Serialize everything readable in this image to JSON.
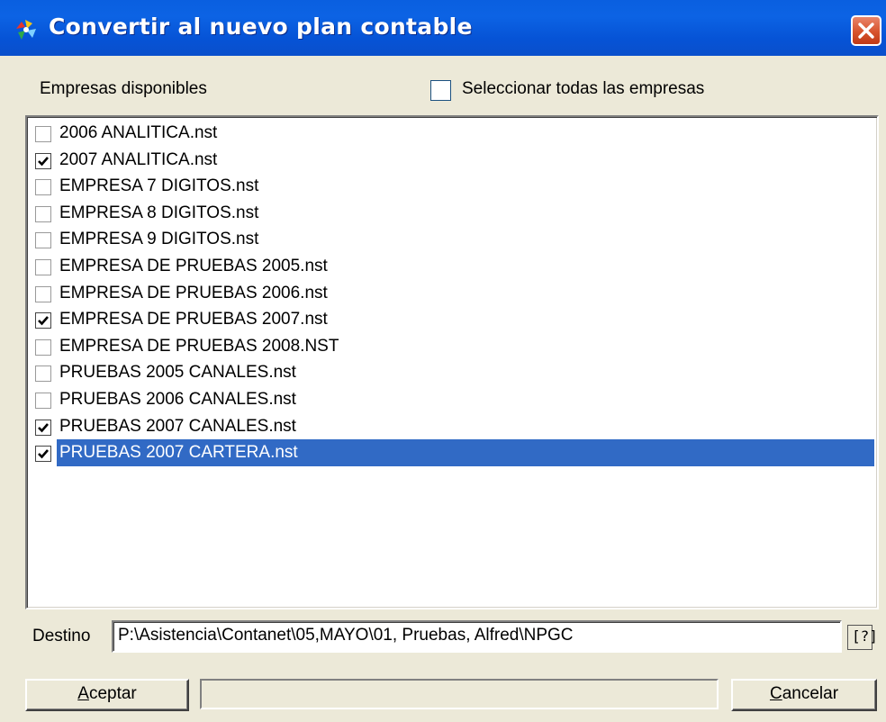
{
  "window": {
    "title": "Convertir al nuevo plan contable"
  },
  "icons": {
    "app": "convert-app-icon",
    "close": "close-icon",
    "browse": "browse-folder-icon",
    "check": "checkmark-icon"
  },
  "colors": {
    "titlebar": "#0a5fe0",
    "close_button": "#d7532c",
    "selection": "#316ac5",
    "dialog_bg": "#ece9d8"
  },
  "header": {
    "available_label": "Empresas disponibles",
    "select_all_label": "Seleccionar todas las empresas",
    "select_all_checked": false
  },
  "companies": [
    {
      "label": "2006 ANALITICA.nst",
      "checked": false,
      "selected": false
    },
    {
      "label": "2007 ANALITICA.nst",
      "checked": true,
      "selected": false
    },
    {
      "label": "EMPRESA 7 DIGITOS.nst",
      "checked": false,
      "selected": false
    },
    {
      "label": "EMPRESA 8 DIGITOS.nst",
      "checked": false,
      "selected": false
    },
    {
      "label": "EMPRESA 9 DIGITOS.nst",
      "checked": false,
      "selected": false
    },
    {
      "label": "EMPRESA DE PRUEBAS 2005.nst",
      "checked": false,
      "selected": false
    },
    {
      "label": "EMPRESA DE PRUEBAS 2006.nst",
      "checked": false,
      "selected": false
    },
    {
      "label": "EMPRESA DE PRUEBAS 2007.nst",
      "checked": true,
      "selected": false
    },
    {
      "label": "EMPRESA DE PRUEBAS 2008.NST",
      "checked": false,
      "selected": false
    },
    {
      "label": "PRUEBAS 2005 CANALES.nst",
      "checked": false,
      "selected": false
    },
    {
      "label": "PRUEBAS 2006 CANALES.nst",
      "checked": false,
      "selected": false
    },
    {
      "label": "PRUEBAS 2007 CANALES.nst",
      "checked": true,
      "selected": false
    },
    {
      "label": "PRUEBAS 2007 CARTERA.nst",
      "checked": true,
      "selected": true
    }
  ],
  "destination": {
    "label": "Destino",
    "value": "P:\\Asistencia\\Contanet\\05,MAYO\\01, Pruebas, Alfred\\NPGC",
    "browse_glyph": "[?]"
  },
  "footer": {
    "accept_accel": "A",
    "accept_rest": "ceptar",
    "cancel_accel": "C",
    "cancel_rest": "ancelar",
    "progress": 0
  }
}
